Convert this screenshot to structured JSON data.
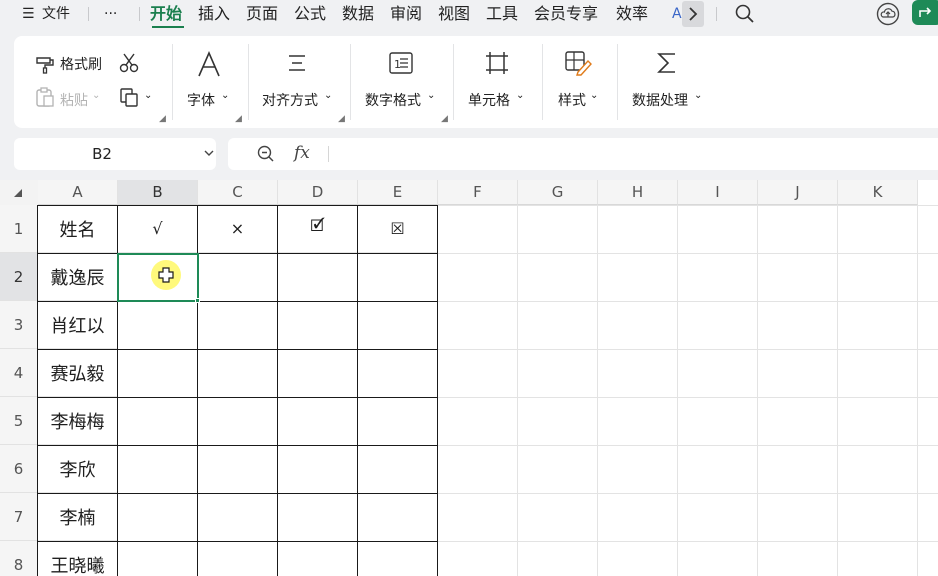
{
  "menu": {
    "file": "文件",
    "more": "···",
    "tabs": [
      "开始",
      "插入",
      "页面",
      "公式",
      "数据",
      "审阅",
      "视图",
      "工具",
      "会员专享",
      "效率"
    ],
    "active_tab": "开始",
    "partial_tab": "A"
  },
  "ribbon": {
    "format_painter": "格式刷",
    "paste": "粘贴",
    "font": "字体",
    "align": "对齐方式",
    "number_format": "数字格式",
    "cell": "单元格",
    "style": "样式",
    "data_process": "数据处理"
  },
  "namebox": {
    "value": "B2"
  },
  "formula": {
    "fx": "fx",
    "value": ""
  },
  "grid": {
    "columns": [
      "A",
      "B",
      "C",
      "D",
      "E",
      "F",
      "G",
      "H",
      "I",
      "J",
      "K"
    ],
    "rows": [
      "1",
      "2",
      "3",
      "4",
      "5",
      "6",
      "7",
      "8"
    ],
    "selected_cell": "B2",
    "header_row": [
      "姓名",
      "√",
      "×",
      "🗹",
      "☒"
    ],
    "names": [
      "戴逸辰",
      "肖红以",
      "赛弘毅",
      "李梅梅",
      "李欣",
      "李楠",
      "王晓曦"
    ]
  },
  "colors": {
    "accent": "#1a7f4e",
    "selection": "#1e8a57"
  }
}
